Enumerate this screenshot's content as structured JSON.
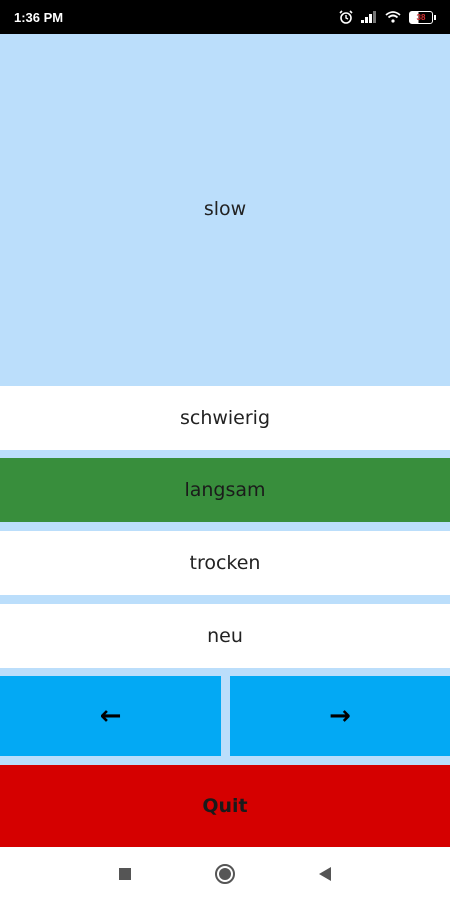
{
  "status_bar": {
    "time": "1:36 PM",
    "battery_level": "38"
  },
  "prompt": {
    "word": "slow"
  },
  "options": [
    {
      "label": "schwierig",
      "selected": false
    },
    {
      "label": "langsam",
      "selected": true
    },
    {
      "label": "trocken",
      "selected": false
    },
    {
      "label": "neu",
      "selected": false
    }
  ],
  "navigation": {
    "prev_label": "←",
    "next_label": "→"
  },
  "quit": {
    "label": "Quit"
  },
  "colors": {
    "prompt_bg": "#bbdefb",
    "selected_option": "#388e3c",
    "nav_button": "#03a9f4",
    "quit_button": "#d50000"
  },
  "system_nav": {
    "recents_icon": "square-icon",
    "home_icon": "circle-icon",
    "back_icon": "triangle-back-icon"
  }
}
